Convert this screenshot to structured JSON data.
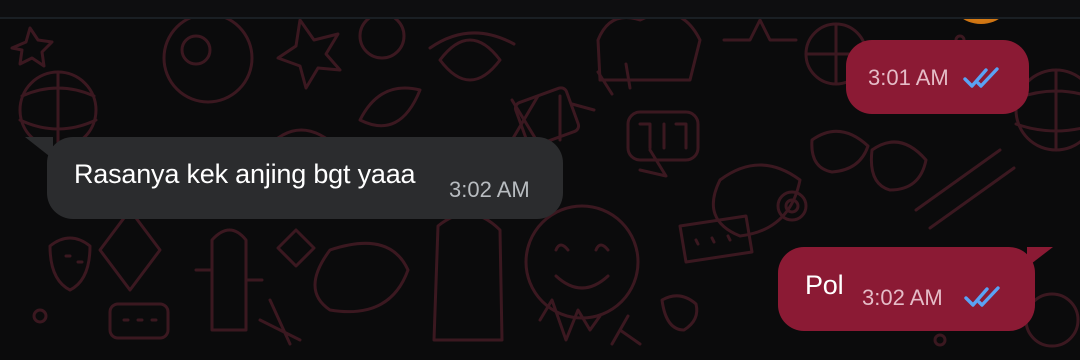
{
  "chat": {
    "messages": [
      {
        "direction": "outgoing",
        "text": "",
        "time": "3:01 AM",
        "status": "read",
        "status_icon": "double-check-icon",
        "bubble_color": "#8b1a34"
      },
      {
        "direction": "incoming",
        "text": "Rasanya kek anjing bgt yaaa",
        "time": "3:02 AM",
        "bubble_color": "#2b2c2e"
      },
      {
        "direction": "outgoing",
        "text": "Pol",
        "time": "3:02 AM",
        "status": "read",
        "status_icon": "double-check-icon",
        "bubble_color": "#8b1a34"
      }
    ]
  },
  "colors": {
    "background": "#0b0b0c",
    "doodle_pattern": "#3b1820",
    "outgoing_bubble": "#8b1a34",
    "incoming_bubble": "#2b2c2e",
    "read_ticks": "#5aa2f4",
    "avatar": "#f39a1d"
  }
}
